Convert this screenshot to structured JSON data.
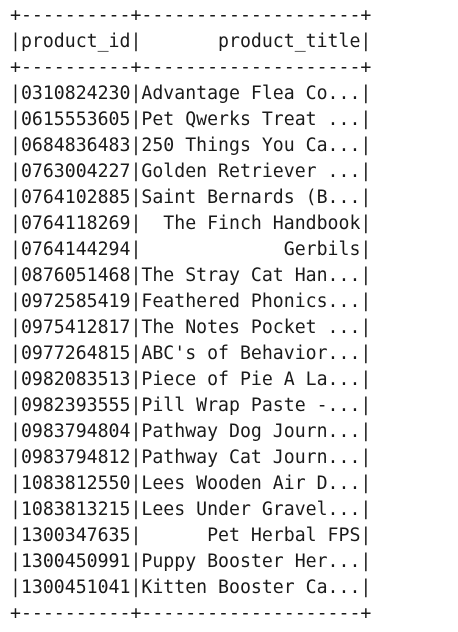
{
  "output": {
    "border": "+----------+--------------------+",
    "header_row": "|product_id|       product_title|",
    "rows": [
      "|0310824230|Advantage Flea Co...|",
      "|0615553605|Pet Qwerks Treat ...|",
      "|0684836483|250 Things You Ca...|",
      "|0763004227|Golden Retriever ...|",
      "|0764102885|Saint Bernards (B...|",
      "|0764118269|  The Finch Handbook|",
      "|0764144294|             Gerbils|",
      "|0876051468|The Stray Cat Han...|",
      "|0972585419|Feathered Phonics...|",
      "|0975412817|The Notes Pocket ...|",
      "|0977264815|ABC's of Behavior...|",
      "|0982083513|Piece of Pie A La...|",
      "|0982393555|Pill Wrap Paste -...|",
      "|0983794804|Pathway Dog Journ...|",
      "|0983794812|Pathway Cat Journ...|",
      "|1083812550|Lees Wooden Air D...|",
      "|1083813215|Lees Under Gravel...|",
      "|1300347635|      Pet Herbal FPS|",
      "|1300450991|Puppy Booster Her...|",
      "|1300451041|Kitten Booster Ca...|"
    ]
  }
}
